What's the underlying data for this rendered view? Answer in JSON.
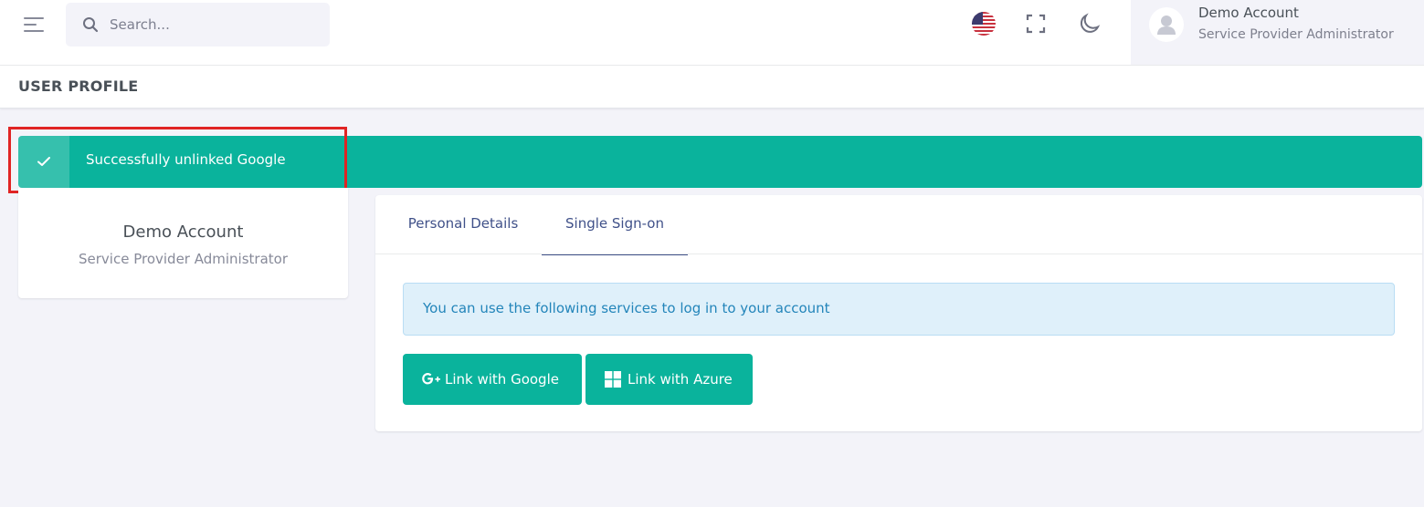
{
  "header": {
    "search_placeholder": "Search...",
    "user": {
      "name": "Demo Account",
      "role": "Service Provider Administrator"
    }
  },
  "page": {
    "title": "USER PROFILE"
  },
  "alert": {
    "message": "Successfully unlinked Google",
    "color": "#0ab39c"
  },
  "profile_card": {
    "name": "Demo Account",
    "role": "Service Provider Administrator"
  },
  "tabs": [
    {
      "label": "Personal Details",
      "active": false
    },
    {
      "label": "Single Sign-on",
      "active": true
    }
  ],
  "sso": {
    "info": "You can use the following services to log in to your account",
    "buttons": [
      {
        "label": "Link with Google",
        "icon": "google-plus-icon"
      },
      {
        "label": "Link with Azure",
        "icon": "windows-icon"
      }
    ]
  },
  "colors": {
    "primary": "#405189",
    "success": "#0ab39c",
    "info_text": "#2385ba",
    "info_bg": "#dff0fa",
    "highlight": "#e02424"
  }
}
